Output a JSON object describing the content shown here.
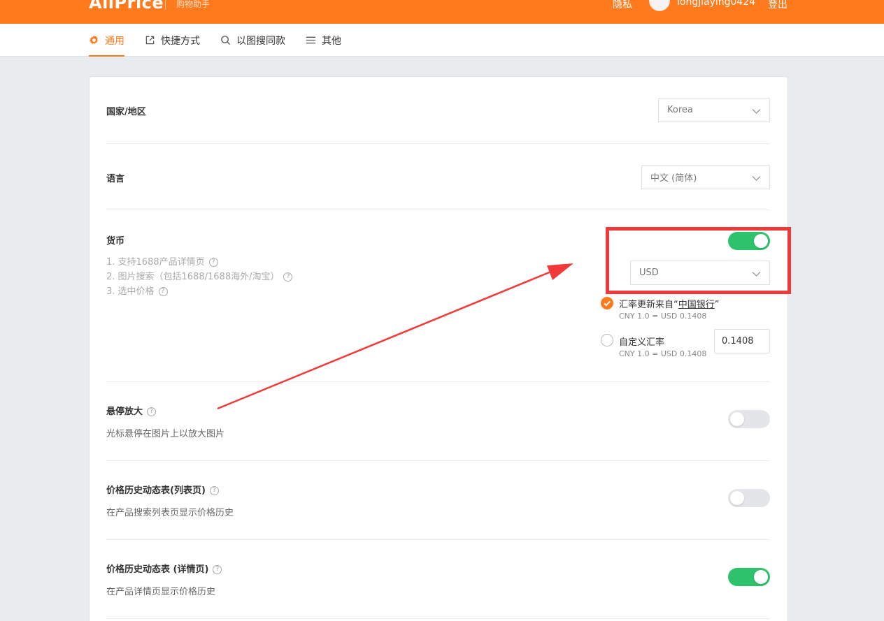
{
  "header": {
    "logo": "AliPrice",
    "subtitle": "购物助手",
    "privacy": "隐私",
    "username": "longjiaying0424",
    "logout": "登出"
  },
  "tabs": [
    {
      "label": "通用",
      "icon": "gear-icon",
      "active": true
    },
    {
      "label": "快捷方式",
      "icon": "external-link-icon",
      "active": false
    },
    {
      "label": "以图搜同款",
      "icon": "search-icon",
      "active": false
    },
    {
      "label": "其他",
      "icon": "menu-icon",
      "active": false
    }
  ],
  "settings": {
    "country": {
      "label": "国家/地区",
      "value": "Korea"
    },
    "language": {
      "label": "语言",
      "value": "中文 (简体)"
    },
    "currency": {
      "label": "货币",
      "notes": [
        "1. 支持1688产品详情页",
        "2. 图片搜索（包括1688/1688海外/淘宝）",
        "3. 选中价格"
      ],
      "enabled": true,
      "value": "USD",
      "rate_bank_prefix": "汇率更新来自“",
      "rate_bank_link": "中国银行",
      "rate_bank_suffix": "”",
      "rate_bank_sub": "CNY 1.0 = USD 0.1408",
      "rate_custom_label": "自定义汇率",
      "rate_custom_sub": "CNY 1.0 = USD 0.1408",
      "rate_custom_value": "0.1408"
    },
    "hover_zoom": {
      "label": "悬停放大",
      "desc": "光标悬停在图片上以放大图片",
      "enabled": false
    },
    "price_history_list": {
      "label": "价格历史动态表(列表页)",
      "desc": "在产品搜索列表页显示价格历史",
      "enabled": false
    },
    "price_history_detail": {
      "label": "价格历史动态表 (详情页)",
      "desc": "在产品详情页显示价格历史",
      "enabled": true
    }
  },
  "colors": {
    "brand": "#ff7a1c",
    "toggle_on": "#2dc26b",
    "annotation": "#f03a3a"
  }
}
